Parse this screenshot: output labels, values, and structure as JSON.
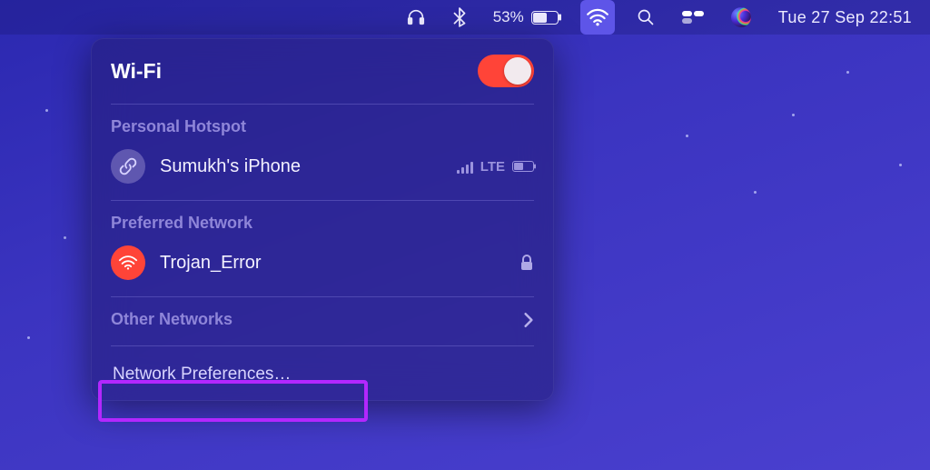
{
  "menubar": {
    "battery_percent": "53%",
    "clock": "Tue 27 Sep  22:51"
  },
  "panel": {
    "title": "Wi-Fi",
    "toggle_on": true,
    "sections": {
      "hotspot": {
        "label": "Personal Hotspot",
        "device_name": "Sumukh's iPhone",
        "network_type": "LTE",
        "battery_fill_pct": 45
      },
      "preferred": {
        "label": "Preferred Network",
        "ssid": "Trojan_Error",
        "locked": true
      },
      "other_label": "Other Networks",
      "prefs_label": "Network Preferences…"
    }
  },
  "colors": {
    "accent_red": "#ff4438",
    "highlight": "#b327ff"
  }
}
